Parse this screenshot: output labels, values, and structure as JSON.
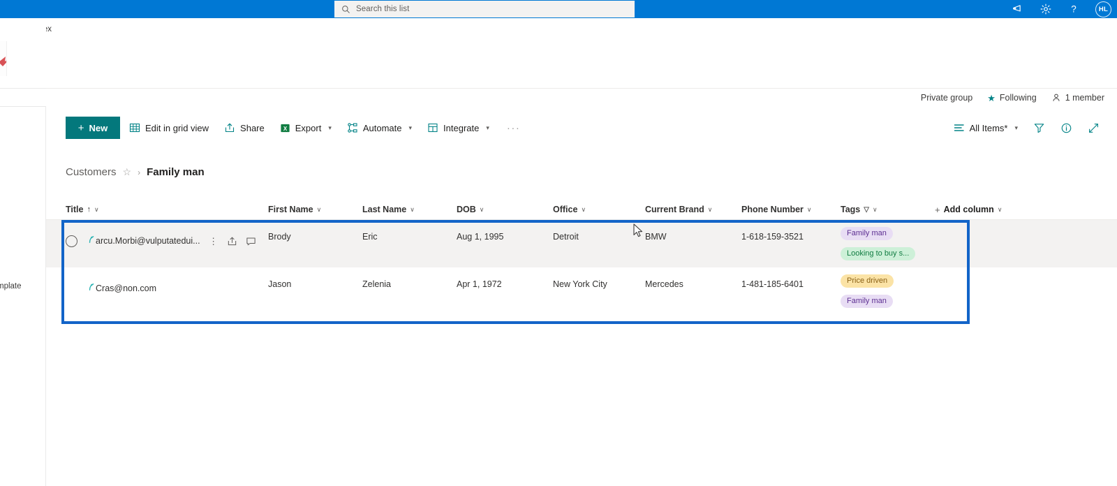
{
  "suitebar": {
    "search_placeholder": "Search this list",
    "icons": [
      {
        "name": "megaphone-icon",
        "label": "Feedback"
      },
      {
        "name": "gear-icon",
        "label": "Settings"
      },
      {
        "name": "help-icon",
        "label": "?"
      }
    ],
    "avatar_initials": "HL"
  },
  "site": {
    "title": "ProjectApex"
  },
  "rail": {
    "template_label": "mplate"
  },
  "group_meta": {
    "privacy": "Private group",
    "following": "Following",
    "members": "1 member"
  },
  "commandbar": {
    "new_label": "New",
    "items": [
      {
        "name": "edit-in-grid-view",
        "label": "Edit in grid view",
        "icon": "grid-icon",
        "chevron": false
      },
      {
        "name": "share",
        "label": "Share",
        "icon": "share-icon",
        "chevron": false
      },
      {
        "name": "export",
        "label": "Export",
        "icon": "excel-icon",
        "chevron": true
      },
      {
        "name": "automate",
        "label": "Automate",
        "icon": "flow-icon",
        "chevron": true
      },
      {
        "name": "integrate",
        "label": "Integrate",
        "icon": "integrate-icon",
        "chevron": true
      }
    ],
    "overflow_label": "···",
    "view_label": "All Items*",
    "right_icons": [
      {
        "name": "filter-icon"
      },
      {
        "name": "info-icon"
      },
      {
        "name": "expand-icon"
      }
    ]
  },
  "breadcrumb": {
    "parent": "Customers",
    "separator": "›",
    "current": "Family man"
  },
  "table": {
    "columns": [
      {
        "key": "title",
        "label": "Title",
        "sort": "↑",
        "chevron": "∨",
        "filtered": false
      },
      {
        "key": "first_name",
        "label": "First Name",
        "sort": "",
        "chevron": "∨",
        "filtered": false
      },
      {
        "key": "last_name",
        "label": "Last Name",
        "sort": "",
        "chevron": "∨",
        "filtered": false
      },
      {
        "key": "dob",
        "label": "DOB",
        "sort": "",
        "chevron": "∨",
        "filtered": false
      },
      {
        "key": "office",
        "label": "Office",
        "sort": "",
        "chevron": "∨",
        "filtered": false
      },
      {
        "key": "current_brand",
        "label": "Current Brand",
        "sort": "",
        "chevron": "∨",
        "filtered": false
      },
      {
        "key": "phone_number",
        "label": "Phone Number",
        "sort": "",
        "chevron": "∨",
        "filtered": false
      },
      {
        "key": "tags",
        "label": "Tags",
        "sort": "",
        "chevron": "∨",
        "filtered": true
      }
    ],
    "add_column_label": "Add column",
    "add_column_plus": "+",
    "rows": [
      {
        "title": "arcu.Morbi@vulputatedui...",
        "first_name": "Brody",
        "last_name": "Eric",
        "dob": "Aug 1, 1995",
        "office": "Detroit",
        "current_brand": "BMW",
        "phone_number": "1-618-159-3521",
        "tags": [
          {
            "label": "Family man",
            "color": "purple"
          },
          {
            "label": "Looking to buy s...",
            "color": "green"
          }
        ]
      },
      {
        "title": "Cras@non.com",
        "first_name": "Jason",
        "last_name": "Zelenia",
        "dob": "Apr 1, 1972",
        "office": "New York City",
        "current_brand": "Mercedes",
        "phone_number": "1-481-185-6401",
        "tags": [
          {
            "label": "Price driven",
            "color": "yellow"
          },
          {
            "label": "Family man",
            "color": "purple"
          }
        ]
      }
    ]
  },
  "colors": {
    "suitebar": "#0078d4",
    "accent_teal": "#03787c",
    "selection_border": "#1264c8",
    "tag_purple": "#e8ddf4",
    "tag_green": "#cdf0d8",
    "tag_yellow": "#fbe3a6"
  }
}
